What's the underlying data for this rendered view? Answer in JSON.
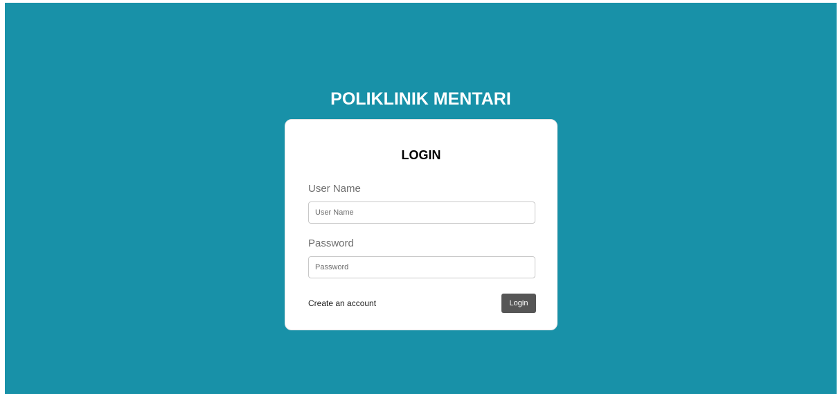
{
  "site": {
    "title": "POLIKLINIK MENTARI"
  },
  "login": {
    "heading": "LOGIN",
    "username_label": "User Name",
    "username_placeholder": "User Name",
    "username_value": "",
    "password_label": "Password",
    "password_placeholder": "Password",
    "password_value": "",
    "create_account_label": "Create an account",
    "submit_label": "Login"
  },
  "colors": {
    "background": "#1891a8",
    "card": "#ffffff",
    "button": "#565656",
    "label": "#6f6f6f"
  }
}
